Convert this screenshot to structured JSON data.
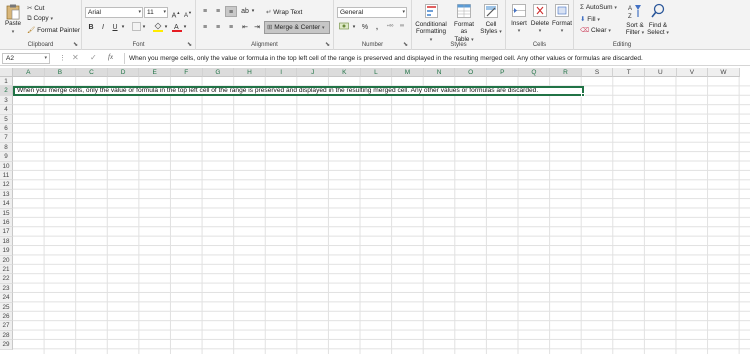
{
  "ribbon": {
    "clipboard": {
      "group_label": "Clipboard",
      "paste": "Paste",
      "cut": "Cut",
      "copy": "Copy",
      "format_painter": "Format Painter"
    },
    "font": {
      "group_label": "Font",
      "font_name": "Arial",
      "font_size": "11",
      "bold": "B",
      "italic": "I",
      "underline": "U"
    },
    "alignment": {
      "group_label": "Alignment",
      "wrap_text": "Wrap Text",
      "merge_center": "Merge & Center"
    },
    "number": {
      "group_label": "Number",
      "format": "General",
      "percent": "%",
      "comma": ","
    },
    "styles": {
      "group_label": "Styles",
      "conditional_formatting": [
        "Conditional",
        "Formatting"
      ],
      "format_as_table": [
        "Format as",
        "Table"
      ],
      "cell_styles": [
        "Cell",
        "Styles"
      ]
    },
    "cells": {
      "group_label": "Cells",
      "insert": "Insert",
      "delete": "Delete",
      "format": "Format"
    },
    "editing": {
      "group_label": "Editing",
      "autosum": "AutoSum",
      "fill": "Fill",
      "clear": "Clear",
      "sort_filter": [
        "Sort &",
        "Filter"
      ],
      "find_select": [
        "Find &",
        "Select"
      ]
    }
  },
  "formula_bar": {
    "name_box": "A2",
    "fx": "fx",
    "content": "When you merge cells, only the value or formula in the top left cell of the range is preserved and displayed in the resulting merged cell. Any other values or formulas are discarded."
  },
  "sheet": {
    "columns": [
      "A",
      "B",
      "C",
      "D",
      "E",
      "F",
      "G",
      "H",
      "I",
      "J",
      "K",
      "L",
      "M",
      "N",
      "O",
      "P",
      "Q",
      "R",
      "S",
      "T",
      "U",
      "V",
      "W"
    ],
    "rows": [
      "1",
      "2",
      "3",
      "4",
      "5",
      "6",
      "7",
      "8",
      "9",
      "10",
      "11",
      "12",
      "13",
      "14",
      "15",
      "16",
      "17",
      "18",
      "19",
      "20",
      "21",
      "22",
      "23",
      "24",
      "25",
      "26",
      "27",
      "28",
      "29"
    ],
    "merged_cell_text": "When you merge cells, only the value or formula in the top left cell of the range is preserved and displayed in the resulting merged cell. Any other values or formulas are discarded."
  },
  "colors": {
    "accent": "#217346",
    "ribbon_bg": "#f3f3f3"
  }
}
